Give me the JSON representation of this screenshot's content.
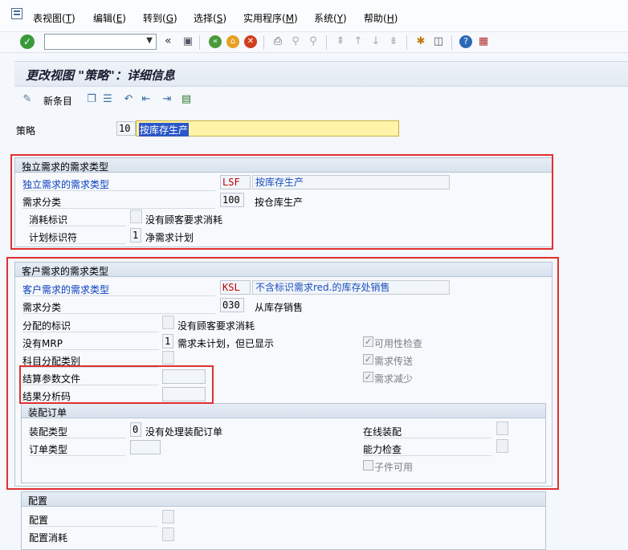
{
  "menu": {
    "items": [
      {
        "label": "表视图(",
        "key": "T",
        "end": ")"
      },
      {
        "label": "编辑(",
        "key": "E",
        "end": ")"
      },
      {
        "label": "转到(",
        "key": "G",
        "end": ")"
      },
      {
        "label": "选择(",
        "key": "S",
        "end": ")"
      },
      {
        "label": "实用程序(",
        "key": "M",
        "end": ")"
      },
      {
        "label": "系统(",
        "key": "Y",
        "end": ")"
      },
      {
        "label": "帮助(",
        "key": "H",
        "end": ")"
      }
    ]
  },
  "toolbar": {
    "command_field_value": "",
    "collapse_glyph": "«"
  },
  "title": "更改视图 \"策略\"：详细信息",
  "app_toolbar": {
    "new_entries_label": "新条目"
  },
  "strategy": {
    "label": "策略",
    "code": "10",
    "desc": "按库存生产"
  },
  "indep": {
    "group_title": "独立需求的需求类型",
    "req_type_label": "独立需求的需求类型",
    "req_type_code": "LSF",
    "req_type_desc": "按库存生产",
    "req_class_label": "需求分类",
    "req_class_code": "100",
    "req_class_desc": "按仓库生产",
    "consumption_label": "消耗标识",
    "consumption_desc": "没有顾客要求消耗",
    "planning_label": "计划标识符",
    "planning_code": "1",
    "planning_desc": "净需求计划"
  },
  "cust": {
    "group_title": "客户需求的需求类型",
    "req_type_label": "客户需求的需求类型",
    "req_type_code": "KSL",
    "req_type_desc": "不含标识需求red.的库存处销售",
    "req_class_label": "需求分类",
    "req_class_code": "030",
    "req_class_desc": "从库存销售",
    "alloc_label": "分配的标识",
    "alloc_desc": "没有顾客要求消耗",
    "no_mrp_label": "没有MRP",
    "no_mrp_code": "1",
    "no_mrp_desc": "需求未计划，但已显示",
    "acct_label": "科目分配类别",
    "settle_label": "结算参数文件",
    "result_label": "结果分析码",
    "availability_label": "可用性检查",
    "req_transfer_label": "需求传送",
    "req_reduction_label": "需求减少"
  },
  "assembly": {
    "group_title": "装配订单",
    "type_label": "装配类型",
    "type_code": "0",
    "type_desc": "没有处理装配订单",
    "order_type_label": "订单类型",
    "online_label": "在线装配",
    "capacity_label": "能力检查",
    "component_label": "子件可用"
  },
  "config": {
    "group_title": "配置",
    "config_label": "配置",
    "config_consumption_label": "配置消耗"
  }
}
